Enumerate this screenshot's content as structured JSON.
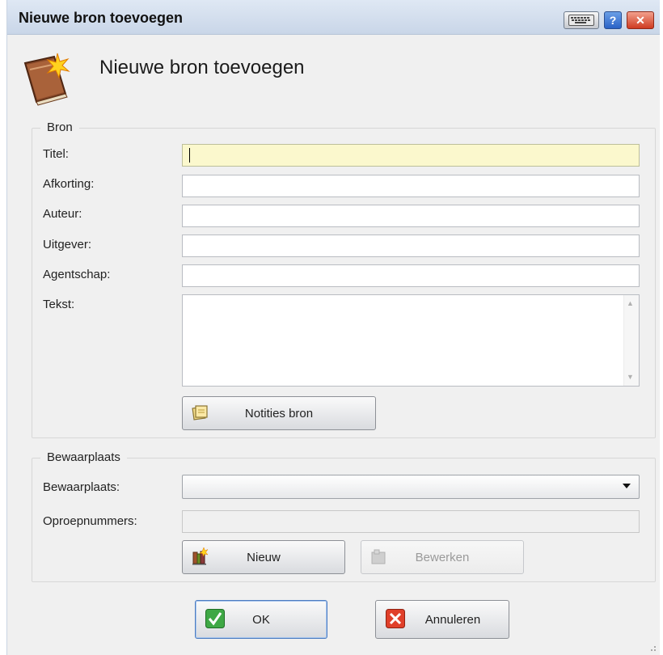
{
  "window": {
    "title": "Nieuwe bron toevoegen",
    "help_glyph": "?",
    "close_glyph": "✕"
  },
  "header": {
    "title": "Nieuwe bron toevoegen",
    "icon": "book-star-icon"
  },
  "bron": {
    "legend": "Bron",
    "fields": {
      "titel": {
        "label": "Titel:",
        "value": ""
      },
      "afkorting": {
        "label": "Afkorting:",
        "value": ""
      },
      "auteur": {
        "label": "Auteur:",
        "value": ""
      },
      "uitgever": {
        "label": "Uitgever:",
        "value": ""
      },
      "agentschap": {
        "label": "Agentschap:",
        "value": ""
      },
      "tekst": {
        "label": "Tekst:",
        "value": ""
      }
    },
    "notes_button": "Notities bron"
  },
  "bewaarplaats": {
    "legend": "Bewaarplaats",
    "select_label": "Bewaarplaats:",
    "select_value": "",
    "oproep_label": "Oproepnummers:",
    "oproep_value": "",
    "new_button": "Nieuw",
    "edit_button": "Bewerken"
  },
  "footer": {
    "ok": "OK",
    "cancel": "Annuleren"
  },
  "colors": {
    "active_field": "#fbf8cd",
    "ok_icon": "#3fa845",
    "cancel_icon": "#e0402a"
  }
}
